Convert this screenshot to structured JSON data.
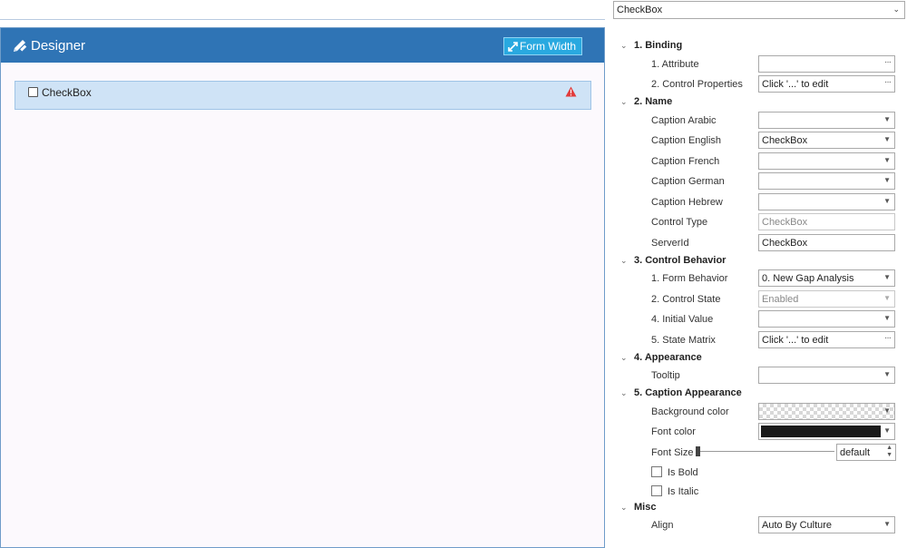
{
  "designer": {
    "title": "Designer",
    "form_width_label": "Form Width",
    "control_label": "CheckBox"
  },
  "control_selector": {
    "value": "CheckBox"
  },
  "sections": {
    "binding": "1. Binding",
    "name": "2. Name",
    "behavior": "3. Control Behavior",
    "appearance": "4. Appearance",
    "caption_appearance": "5. Caption Appearance",
    "misc": "Misc"
  },
  "props": {
    "attribute": {
      "label": "1. Attribute",
      "value": ""
    },
    "control_properties": {
      "label": "2. Control Properties",
      "value": "Click '...' to edit"
    },
    "caption_arabic": {
      "label": "Caption Arabic",
      "value": ""
    },
    "caption_english": {
      "label": "Caption English",
      "value": "CheckBox"
    },
    "caption_french": {
      "label": "Caption French",
      "value": ""
    },
    "caption_german": {
      "label": "Caption German",
      "value": ""
    },
    "caption_hebrew": {
      "label": "Caption Hebrew",
      "value": ""
    },
    "control_type": {
      "label": "Control Type",
      "value": "CheckBox"
    },
    "server_id": {
      "label": "ServerId",
      "value": "CheckBox"
    },
    "form_behavior": {
      "label": "1. Form Behavior",
      "value": "0. New Gap Analysis"
    },
    "control_state": {
      "label": "2. Control State",
      "value": "Enabled"
    },
    "initial_value": {
      "label": "4. Initial Value",
      "value": ""
    },
    "state_matrix": {
      "label": "5. State Matrix",
      "value": "Click '...' to edit"
    },
    "tooltip": {
      "label": "Tooltip",
      "value": ""
    },
    "background_color": {
      "label": "Background color"
    },
    "font_color": {
      "label": "Font color",
      "color": "#1a1a1a"
    },
    "font_size": {
      "label": "Font Size",
      "value": "default"
    },
    "is_bold": {
      "label": "Is Bold",
      "checked": false
    },
    "is_italic": {
      "label": "Is Italic",
      "checked": false
    },
    "align": {
      "label": "Align",
      "value": "Auto By Culture"
    }
  },
  "colors": {
    "header": "#2f74b5",
    "accent_button": "#29a9e0",
    "selected_row": "#cfe3f6",
    "warning": "#e23b3b"
  }
}
